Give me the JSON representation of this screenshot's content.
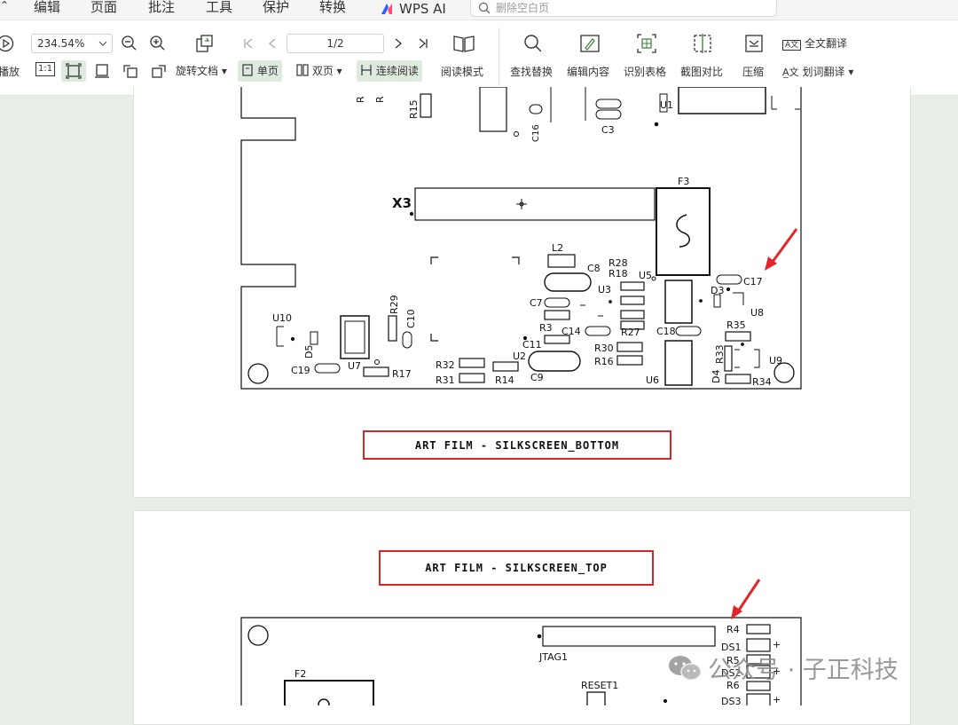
{
  "menu": {
    "items": [
      "编辑",
      "页面",
      "批注",
      "工具",
      "保护",
      "转换"
    ],
    "ai_label": "WPS AI",
    "search_placeholder": "删除空白页"
  },
  "toolbar": {
    "play_label": "播放",
    "zoom_value": "234.54%",
    "page_indicator": "1/2",
    "actual_size_glyph": "1:1",
    "rotate_label": "旋转文档",
    "single_page_label": "单页",
    "double_page_label": "双页",
    "continuous_label": "连续阅读",
    "reading_mode_label": "阅读模式",
    "find_replace_label": "查找替换",
    "edit_content_label": "编辑内容",
    "recognize_table_label": "识别表格",
    "screenshot_compare_label": "截图对比",
    "compress_label": "压缩",
    "full_translate_label": "全文翻译",
    "word_translate_label": "划词翻译"
  },
  "document": {
    "caption_bottom": "ART FILM - SILKSCREEN_BOTTOM",
    "caption_top": "ART FILM - SILKSCREEN_TOP",
    "pcb_bottom_labels": {
      "x3": "X3",
      "f3": "F3",
      "u1": "U1",
      "c3": "C3",
      "c16": "C16",
      "r15": "R15",
      "r_top": "R",
      "l2": "L2",
      "c8": "C8",
      "r28": "R28",
      "r18": "R18",
      "u5": "U5",
      "u3": "U3",
      "c17": "C17",
      "d3": "D3",
      "u8": "U8",
      "c7": "C7",
      "c14": "C14",
      "r3": "R3",
      "c11": "C11",
      "r27": "R27",
      "c18": "C18",
      "r35": "R35",
      "r30": "R30",
      "r33": "R33",
      "r16": "R16",
      "u9": "U9",
      "d4": "D4",
      "r34": "R34",
      "u6": "U6",
      "u2": "U2",
      "c9": "C9",
      "r14": "R14",
      "r32": "R32",
      "r31": "R31",
      "r29": "R29",
      "c10": "C10",
      "u10": "U10",
      "d5": "D5",
      "c19": "C19",
      "u7": "U7",
      "r17": "R17"
    },
    "pcb_top_labels": {
      "jtag1": "JTAG1",
      "f2": "F2",
      "reset1": "RESET1",
      "r4": "R4",
      "ds1": "DS1",
      "r5": "R5",
      "ds2": "DS2",
      "r6": "R6",
      "ds3": "DS3",
      "plus": "+"
    }
  },
  "watermark": {
    "text": "公众号 · 子正科技"
  },
  "colors": {
    "accent_red": "#d5262b",
    "active_toggle": "#dfeadf",
    "background": "#e9efe8"
  }
}
